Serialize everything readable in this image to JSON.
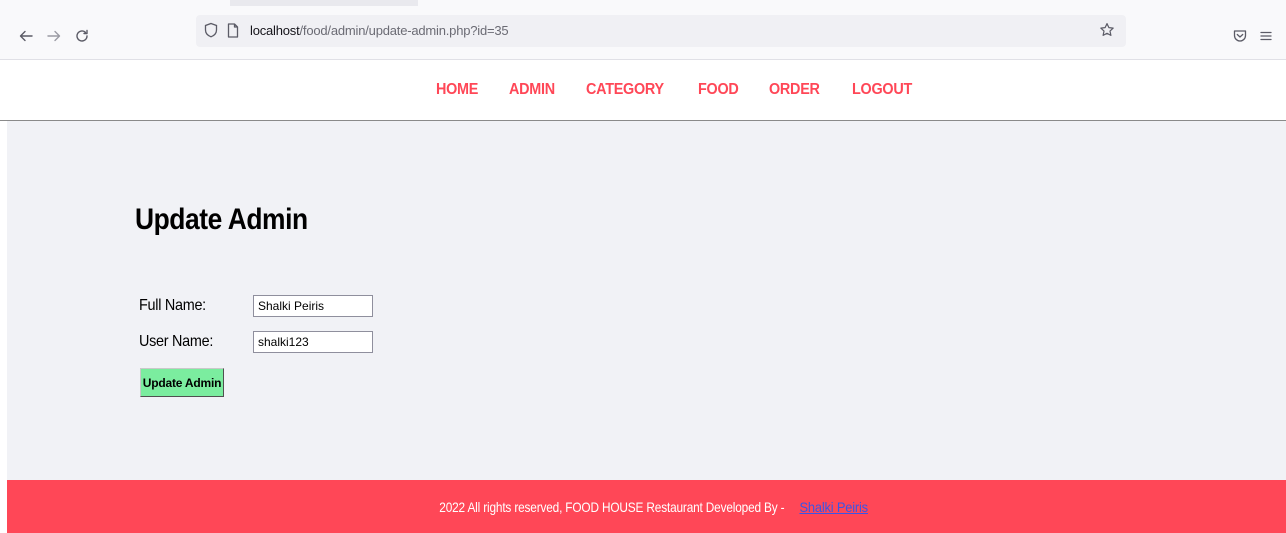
{
  "browser": {
    "url_host": "localhost",
    "url_path": "/food/admin/update-admin.php?id=35",
    "icons": [
      "back-arrow-icon",
      "forward-arrow-icon",
      "reload-icon",
      "tracking-shield-icon",
      "page-icon",
      "bookmark-star-icon",
      "pocket-icon",
      "hamburger-menu-icon"
    ]
  },
  "nav": {
    "items": [
      {
        "label": "HOME"
      },
      {
        "label": "ADMIN"
      },
      {
        "label": "CATEGORY"
      },
      {
        "label": "FOOD"
      },
      {
        "label": "ORDER"
      },
      {
        "label": "LOGOUT"
      }
    ]
  },
  "form": {
    "title": "Update Admin",
    "full_name_label": "Full Name:",
    "full_name_value": "Shalki Peiris",
    "user_name_label": "User Name:",
    "user_name_value": "shalki123",
    "submit_label": "Update Admin"
  },
  "footer": {
    "text": "2022 All rights reserved, FOOD HOUSE Restaurant Developed By - ",
    "link_text": "Shalki Peiris"
  },
  "colors": {
    "accent": "#ff4757",
    "page_bg": "#f1f2f6",
    "button_bg": "#7bed9f",
    "footer_link": "#3a55e6"
  }
}
